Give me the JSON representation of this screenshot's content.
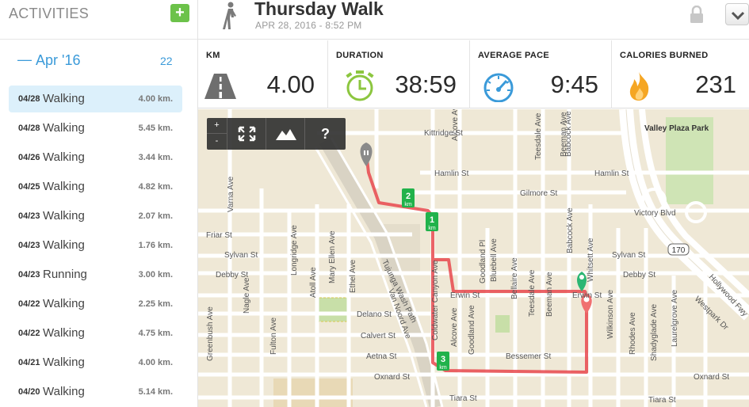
{
  "sidebar": {
    "title": "ACTIVITIES",
    "add_label": "+",
    "month": {
      "dash": "—",
      "label": "Apr '16",
      "count": "22"
    },
    "activities": [
      {
        "date": "04/28",
        "type": "Walking",
        "distance": "4.00 km.",
        "selected": true
      },
      {
        "date": "04/28",
        "type": "Walking",
        "distance": "5.45 km."
      },
      {
        "date": "04/26",
        "type": "Walking",
        "distance": "3.44 km."
      },
      {
        "date": "04/25",
        "type": "Walking",
        "distance": "4.82 km."
      },
      {
        "date": "04/23",
        "type": "Walking",
        "distance": "2.07 km."
      },
      {
        "date": "04/23",
        "type": "Walking",
        "distance": "1.76 km."
      },
      {
        "date": "04/23",
        "type": "Running",
        "distance": "3.00 km."
      },
      {
        "date": "04/22",
        "type": "Walking",
        "distance": "2.25 km."
      },
      {
        "date": "04/22",
        "type": "Walking",
        "distance": "4.75 km."
      },
      {
        "date": "04/21",
        "type": "Walking",
        "distance": "4.00 km."
      },
      {
        "date": "04/20",
        "type": "Walking",
        "distance": "5.14 km."
      }
    ]
  },
  "header": {
    "title": "Thursday Walk",
    "subtitle": "APR 28, 2016  -  8:52 PM",
    "activity_icon": "walker-icon",
    "lock_icon": "lock-icon",
    "dropdown_icon": "chevron-down-icon"
  },
  "stats": {
    "km": {
      "label": "KM",
      "value": "4.00",
      "icon": "road-icon"
    },
    "duration": {
      "label": "DURATION",
      "value": "38:59",
      "icon": "stopwatch-icon"
    },
    "pace": {
      "label": "AVERAGE PACE",
      "value": "9:45",
      "icon": "speedometer-icon"
    },
    "calories": {
      "label": "CALORIES BURNED",
      "value": "231",
      "icon": "flame-icon"
    }
  },
  "colors": {
    "accent": "#3a9ad9",
    "add_green": "#6cc24a",
    "route": "#e8484e",
    "stopwatch": "#8cc63f",
    "flame": "#f5a623",
    "selected_row": "#dcf0fb"
  },
  "map": {
    "controls": {
      "zoom_in": "+",
      "zoom_out": "-",
      "help": "?"
    },
    "km_markers": [
      {
        "num": "1",
        "unit": "km"
      },
      {
        "num": "2",
        "unit": "km"
      },
      {
        "num": "3",
        "unit": "km"
      }
    ],
    "streets": {
      "kittridge": "Kittridge St",
      "hamlin_left": "Hamlin St",
      "hamlin_right": "Hamlin St",
      "gilmore": "Gilmore St",
      "victory": "Victory Blvd",
      "friar": "Friar St",
      "sylvan_left": "Sylvan St",
      "sylvan_right": "Sylvan St",
      "debby_left": "Debby St",
      "debby_right": "Debby St",
      "erwin_mid": "Erwin St",
      "erwin_right": "Erwin St",
      "delano": "Delano St",
      "calvert": "Calvert St",
      "aetna": "Aetna St",
      "bessemer": "Bessemer St",
      "oxnard_left": "Oxnard St",
      "oxnard_right": "Oxnard St",
      "tiara_mid": "Tiara St",
      "tiara_right": "Tiara St",
      "goodland_pl": "Goodland Pl",
      "goodland_ave": "Goodland Ave",
      "bluebell": "Bluebell Ave",
      "bellaire": "Bellaire Ave",
      "teesdale_top": "Teesdale Ave",
      "teesdale_bottom": "Teesdale Ave",
      "beeman_top": "Beeman Ave",
      "beeman_bottom": "Beeman Ave",
      "babcock_top": "Babcock Ave",
      "babcock_bottom": "Babcock Ave",
      "whitsett": "Whitsett Ave",
      "wilkinson": "Wilkinson Ave",
      "rhodes": "Rhodes Ave",
      "shadygrade": "Shadyglade Ave",
      "laurelgrove": "Laurelgrove Ave",
      "varna": "Varna Ave",
      "nagle": "Nagle Ave",
      "greenbush": "Greenbush Ave",
      "longridge": "Longridge Ave",
      "fulton": "Fulton Ave",
      "atoll": "Atoll Ave",
      "mary_ellen": "Mary Ellen Ave",
      "ethel": "Ethel Ave",
      "van_noord": "Van Noord Ave",
      "tujunga": "Tujunga Wash Path",
      "coldwater": "Coldwater Canyon Ave",
      "alcove": "Alcove Ave",
      "hollywood": "Hollywood Fwy",
      "westpark": "Westpark Dr",
      "valley_plaza": "Valley Plaza Park",
      "shield_170": "170"
    }
  }
}
